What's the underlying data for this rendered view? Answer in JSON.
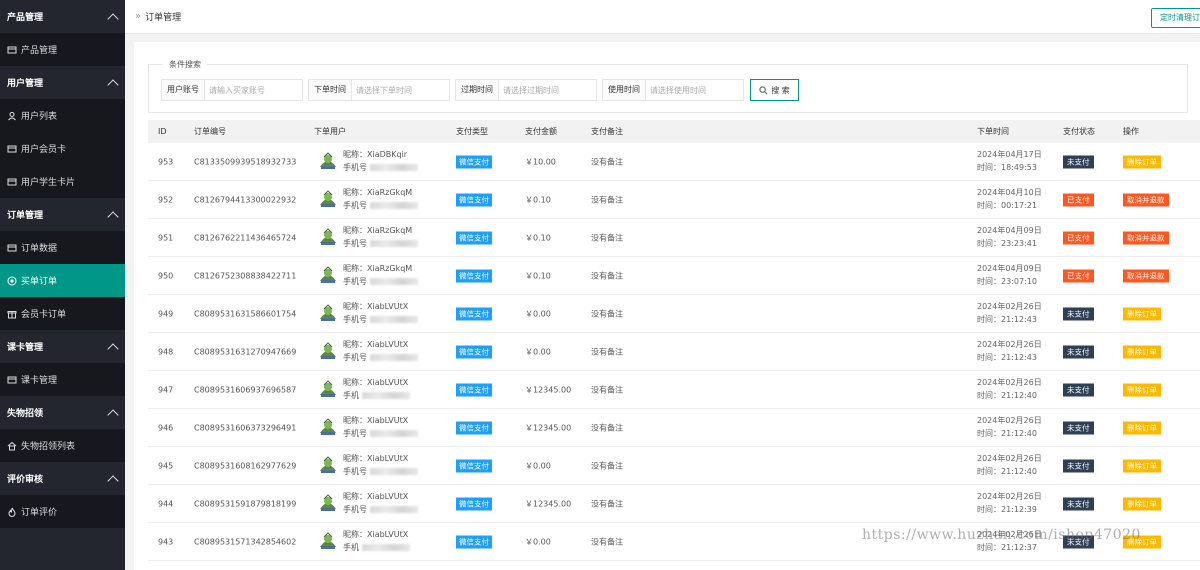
{
  "sidebar": {
    "groups": [
      {
        "title": "产品管理",
        "items": [
          {
            "label": "产品管理",
            "icon": "card-icon",
            "active": false
          }
        ]
      },
      {
        "title": "用户管理",
        "items": [
          {
            "label": "用户列表",
            "icon": "user-icon",
            "active": false
          },
          {
            "label": "用户会员卡",
            "icon": "card-icon",
            "active": false
          },
          {
            "label": "用户学生卡片",
            "icon": "card-icon",
            "active": false
          }
        ]
      },
      {
        "title": "订单管理",
        "items": [
          {
            "label": "订单数据",
            "icon": "card-icon",
            "active": false
          },
          {
            "label": "买单订单",
            "icon": "target-icon",
            "active": true
          },
          {
            "label": "会员卡订单",
            "icon": "gift-icon",
            "active": false
          }
        ]
      },
      {
        "title": "课卡管理",
        "items": [
          {
            "label": "课卡管理",
            "icon": "card-icon",
            "active": false
          }
        ]
      },
      {
        "title": "失物招领",
        "items": [
          {
            "label": "失物招领列表",
            "icon": "home-icon",
            "active": false
          }
        ]
      },
      {
        "title": "评价审核",
        "items": [
          {
            "label": "订单评价",
            "icon": "fire-icon",
            "active": false
          }
        ]
      }
    ]
  },
  "topbar": {
    "breadcrumb_sep": "»",
    "breadcrumb": "订单管理",
    "cron_button": "定时清理订单"
  },
  "search": {
    "legend": "条件搜索",
    "user_label": "用户账号",
    "user_placeholder": "请输入买家账号",
    "order_time_label": "下单时间",
    "order_time_placeholder": "请选择下单时间",
    "expire_label": "过期时间",
    "expire_placeholder": "请选择过期时间",
    "use_label": "使用时间",
    "use_placeholder": "请选择使用时间",
    "button": "搜 索"
  },
  "table": {
    "headers": {
      "id": "ID",
      "order_no": "订单编号",
      "user": "下单用户",
      "pay_type": "支付类型",
      "amount": "支付金额",
      "remark": "支付备注",
      "time": "下单时间",
      "status": "支付状态",
      "action": "操作"
    },
    "rows": [
      {
        "id": "953",
        "order_no": "C8133509939518932733",
        "nick": "昵称：XiaDBKqir",
        "phone": "手机号",
        "pay_type": "微信支付",
        "amount": "￥10.00",
        "remark": "没有备注",
        "date": "2024年04月17日",
        "time": "时间：18:49:53",
        "status": "未支付",
        "action": "删除订单"
      },
      {
        "id": "952",
        "order_no": "C8126794413300022932",
        "nick": "昵称：XiaRzGkqM",
        "phone": "手机号",
        "pay_type": "微信支付",
        "amount": "￥0.10",
        "remark": "没有备注",
        "date": "2024年04月10日",
        "time": "时间：00:17:21",
        "status": "已支付",
        "action": "取消并退款"
      },
      {
        "id": "951",
        "order_no": "C8126762211436465724",
        "nick": "昵称：XiaRzGkqM",
        "phone": "手机号",
        "pay_type": "微信支付",
        "amount": "￥0.10",
        "remark": "没有备注",
        "date": "2024年04月09日",
        "time": "时间：23:23:41",
        "status": "已支付",
        "action": "取消并退款"
      },
      {
        "id": "950",
        "order_no": "C8126752308838422711",
        "nick": "昵称：XiaRzGkqM",
        "phone": "手机号",
        "pay_type": "微信支付",
        "amount": "￥0.10",
        "remark": "没有备注",
        "date": "2024年04月09日",
        "time": "时间：23:07:10",
        "status": "已支付",
        "action": "取消并退款"
      },
      {
        "id": "949",
        "order_no": "C8089531631586601754",
        "nick": "昵称：XiabLVUtX",
        "phone": "手机号",
        "pay_type": "微信支付",
        "amount": "￥0.00",
        "remark": "没有备注",
        "date": "2024年02月26日",
        "time": "时间：21:12:43",
        "status": "未支付",
        "action": "删除订单"
      },
      {
        "id": "948",
        "order_no": "C8089531631270947669",
        "nick": "昵称：XiabLVUtX",
        "phone": "手机号",
        "pay_type": "微信支付",
        "amount": "￥0.00",
        "remark": "没有备注",
        "date": "2024年02月26日",
        "time": "时间：21:12:43",
        "status": "未支付",
        "action": "删除订单"
      },
      {
        "id": "947",
        "order_no": "C8089531606937696587",
        "nick": "昵称：XiabLVUtX",
        "phone": "手机",
        "pay_type": "微信支付",
        "amount": "￥12345.00",
        "remark": "没有备注",
        "date": "2024年02月26日",
        "time": "时间：21:12:40",
        "status": "未支付",
        "action": "删除订单"
      },
      {
        "id": "946",
        "order_no": "C8089531606373296491",
        "nick": "昵称：XiabLVUtX",
        "phone": "手机号",
        "pay_type": "微信支付",
        "amount": "￥12345.00",
        "remark": "没有备注",
        "date": "2024年02月26日",
        "time": "时间：21:12:40",
        "status": "未支付",
        "action": "删除订单"
      },
      {
        "id": "945",
        "order_no": "C8089531608162977629",
        "nick": "昵称：XiabLVUtX",
        "phone": "手机号",
        "pay_type": "微信支付",
        "amount": "￥0.00",
        "remark": "没有备注",
        "date": "2024年02月26日",
        "time": "时间：21:12:40",
        "status": "未支付",
        "action": "删除订单"
      },
      {
        "id": "944",
        "order_no": "C8089531591879818199",
        "nick": "昵称：XiabLVUtX",
        "phone": "手机号",
        "pay_type": "微信支付",
        "amount": "￥12345.00",
        "remark": "没有备注",
        "date": "2024年02月26日",
        "time": "时间：21:12:39",
        "status": "未支付",
        "action": "删除订单"
      },
      {
        "id": "943",
        "order_no": "C8089531571342854602",
        "nick": "昵称：XiabLVUtX",
        "phone": "手机",
        "pay_type": "微信支付",
        "amount": "￥0.00",
        "remark": "没有备注",
        "date": "2024年02月26日",
        "time": "时间：21:12:37",
        "status": "未支付",
        "action": "删除订单"
      }
    ]
  },
  "watermark": "https://www.huzhan.com/ishop47020",
  "colors": {
    "unpaid": "#2f4056",
    "paid": "#ff5722",
    "delete": "#ffb800",
    "refund": "#ff5722",
    "pay_type": "#1e9fff",
    "active": "#009688"
  }
}
